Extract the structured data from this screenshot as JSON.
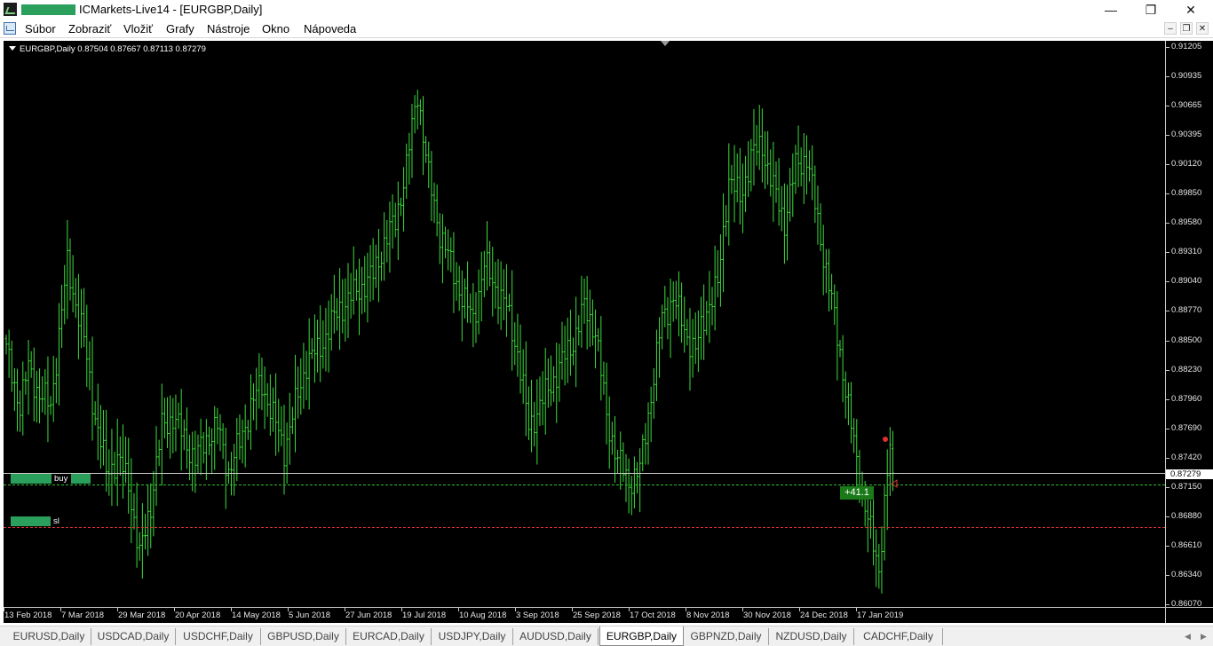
{
  "window": {
    "title": "ICMarkets-Live14 - [EURGBP,Daily]",
    "minimize": "—",
    "maximize": "❐",
    "close": "✕"
  },
  "menu": {
    "items": [
      "Súbor",
      "Zobraziť",
      "Vložiť",
      "Grafy",
      "Nástroje",
      "Okno",
      "Nápoveda"
    ],
    "mdi": [
      "–",
      "❐",
      "✕"
    ]
  },
  "chart": {
    "symbol_line": "EURGBP,Daily  0.87504 0.87667 0.87113 0.87279",
    "bid_label": "0.87279",
    "buy_label": "buy",
    "sl_label": "sl",
    "profit_label": "+41.1",
    "colors": {
      "bull": "#3ddc3d",
      "bid": "#c8c8c8",
      "buy": "#2fbf2f",
      "sl": "#e03030",
      "mask": "#2aa05c"
    }
  },
  "chart_data": {
    "type": "bar",
    "symbol": "EURGBP",
    "timeframe": "Daily",
    "ohlc_last": {
      "open": 0.87504,
      "high": 0.87667,
      "low": 0.87113,
      "close": 0.87279
    },
    "ylim": [
      0.8607,
      0.91205
    ],
    "y_ticks": [
      "0.91205",
      "0.90935",
      "0.90665",
      "0.90395",
      "0.90120",
      "0.89850",
      "0.89580",
      "0.89310",
      "0.89040",
      "0.88770",
      "0.88500",
      "0.88230",
      "0.87960",
      "0.87690",
      "0.87420",
      "0.87150",
      "0.86880",
      "0.86610",
      "0.86340",
      "0.86070"
    ],
    "x_ticks": [
      "13 Feb 2018",
      "7 Mar 2018",
      "29 Mar 2018",
      "20 Apr 2018",
      "14 May 2018",
      "5 Jun 2018",
      "27 Jun 2018",
      "19 Jul 2018",
      "10 Aug 2018",
      "3 Sep 2018",
      "25 Sep 2018",
      "17 Oct 2018",
      "8 Nov 2018",
      "30 Nov 2018",
      "24 Dec 2018",
      "17 Jan 2019"
    ],
    "anchors": [
      [
        0,
        0.884
      ],
      [
        5,
        0.879
      ],
      [
        8,
        0.8825
      ],
      [
        12,
        0.88
      ],
      [
        16,
        0.879
      ],
      [
        22,
        0.892
      ],
      [
        28,
        0.885
      ],
      [
        32,
        0.878
      ],
      [
        36,
        0.873
      ],
      [
        40,
        0.874
      ],
      [
        44,
        0.872
      ],
      [
        48,
        0.865
      ],
      [
        52,
        0.87
      ],
      [
        56,
        0.877
      ],
      [
        60,
        0.878
      ],
      [
        64,
        0.876
      ],
      [
        68,
        0.874
      ],
      [
        72,
        0.876
      ],
      [
        76,
        0.877
      ],
      [
        80,
        0.873
      ],
      [
        84,
        0.8755
      ],
      [
        88,
        0.879
      ],
      [
        92,
        0.881
      ],
      [
        96,
        0.878
      ],
      [
        100,
        0.875
      ],
      [
        104,
        0.879
      ],
      [
        108,
        0.883
      ],
      [
        112,
        0.884
      ],
      [
        116,
        0.886
      ],
      [
        120,
        0.888
      ],
      [
        124,
        0.889
      ],
      [
        128,
        0.89
      ],
      [
        132,
        0.891
      ],
      [
        136,
        0.894
      ],
      [
        140,
        0.896
      ],
      [
        144,
        0.901
      ],
      [
        148,
        0.908
      ],
      [
        152,
        0.9
      ],
      [
        156,
        0.895
      ],
      [
        160,
        0.892
      ],
      [
        164,
        0.889
      ],
      [
        168,
        0.887
      ],
      [
        172,
        0.892
      ],
      [
        176,
        0.89
      ],
      [
        180,
        0.888
      ],
      [
        184,
        0.884
      ],
      [
        188,
        0.877
      ],
      [
        192,
        0.879
      ],
      [
        196,
        0.881
      ],
      [
        200,
        0.883
      ],
      [
        204,
        0.885
      ],
      [
        208,
        0.888
      ],
      [
        212,
        0.886
      ],
      [
        216,
        0.878
      ],
      [
        220,
        0.874
      ],
      [
        224,
        0.872
      ],
      [
        228,
        0.873
      ],
      [
        232,
        0.88
      ],
      [
        236,
        0.887
      ],
      [
        240,
        0.889
      ],
      [
        244,
        0.886
      ],
      [
        248,
        0.884
      ],
      [
        252,
        0.888
      ],
      [
        256,
        0.89
      ],
      [
        260,
        0.9
      ],
      [
        264,
        0.898
      ],
      [
        268,
        0.902
      ],
      [
        272,
        0.903
      ],
      [
        276,
        0.899
      ],
      [
        280,
        0.896
      ],
      [
        284,
        0.901
      ],
      [
        288,
        0.902
      ],
      [
        292,
        0.896
      ],
      [
        296,
        0.89
      ],
      [
        300,
        0.884
      ],
      [
        304,
        0.877
      ],
      [
        308,
        0.871
      ],
      [
        312,
        0.866
      ],
      [
        314,
        0.864
      ],
      [
        316,
        0.87
      ],
      [
        318,
        0.875
      ],
      [
        319,
        0.8728
      ]
    ]
  },
  "tabs": [
    "EURUSD,Daily",
    "USDCAD,Daily",
    "USDCHF,Daily",
    "GBPUSD,Daily",
    "EURCAD,Daily",
    "USDJPY,Daily",
    "AUDUSD,Daily",
    "EURGBP,Daily",
    "GBPNZD,Daily",
    "NZDUSD,Daily",
    "CADCHF,Daily"
  ],
  "active_tab": 7,
  "tab_nav": {
    "left": "◀",
    "right": "▶"
  }
}
